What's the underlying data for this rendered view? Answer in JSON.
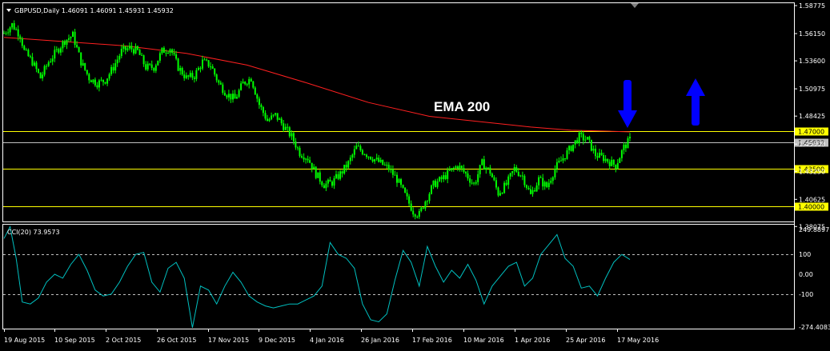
{
  "chart_data": [
    {
      "type": "candlestick",
      "title": "GBPUSD,Daily  1.46091 1.46091 1.45931 1.45932",
      "symbol": "GBPUSD",
      "timeframe": "Daily",
      "ohlc": {
        "open": 1.46091,
        "high": 1.46091,
        "low": 1.45931,
        "close": 1.45932
      },
      "ylim": [
        1.3855,
        1.59
      ],
      "y_ticks": [
        1.58775,
        1.5615,
        1.536,
        1.50975,
        1.48425,
        1.458,
        1.4325,
        1.40625,
        1.38075
      ],
      "y_tick_labels": [
        "1.58775",
        "1.56150",
        "1.53600",
        "1.50975",
        "1.48425",
        "1.45800",
        "1.43250",
        "1.40625",
        "1.38075"
      ],
      "x_tick_labels": [
        "19 Aug 2015",
        "10 Sep 2015",
        "2 Oct 2015",
        "26 Oct 2015",
        "17 Nov 2015",
        "9 Dec 2015",
        "4 Jan 2016",
        "26 Jan 2016",
        "17 Feb 2016",
        "10 Mar 2016",
        "1 Apr 2016",
        "25 Apr 2016",
        "17 May 2016"
      ],
      "horizontal_levels": [
        {
          "value": 1.47,
          "label": "1.47000",
          "color": "#ffff00"
        },
        {
          "value": 1.435,
          "label": "1.43500",
          "color": "#ffff00"
        },
        {
          "value": 1.4,
          "label": "1.40000",
          "color": "#ffff00"
        },
        {
          "value": 1.45932,
          "label": "1.45932",
          "color": "#c0c0c0"
        }
      ],
      "close_path": [
        [
          0,
          1.562
        ],
        [
          4,
          1.57
        ],
        [
          8,
          1.56
        ],
        [
          10,
          1.545
        ],
        [
          14,
          1.535
        ],
        [
          18,
          1.52
        ],
        [
          22,
          1.535
        ],
        [
          26,
          1.545
        ],
        [
          30,
          1.555
        ],
        [
          34,
          1.56
        ],
        [
          38,
          1.535
        ],
        [
          42,
          1.52
        ],
        [
          46,
          1.515
        ],
        [
          50,
          1.518
        ],
        [
          54,
          1.53
        ],
        [
          58,
          1.545
        ],
        [
          62,
          1.548
        ],
        [
          66,
          1.545
        ],
        [
          70,
          1.53
        ],
        [
          74,
          1.53
        ],
        [
          78,
          1.545
        ],
        [
          82,
          1.548
        ],
        [
          86,
          1.53
        ],
        [
          90,
          1.52
        ],
        [
          94,
          1.522
        ],
        [
          98,
          1.535
        ],
        [
          102,
          1.532
        ],
        [
          106,
          1.515
        ],
        [
          110,
          1.505
        ],
        [
          114,
          1.5
        ],
        [
          118,
          1.515
        ],
        [
          122,
          1.52
        ],
        [
          126,
          1.495
        ],
        [
          130,
          1.48
        ],
        [
          134,
          1.485
        ],
        [
          138,
          1.475
        ],
        [
          142,
          1.465
        ],
        [
          146,
          1.45
        ],
        [
          150,
          1.445
        ],
        [
          154,
          1.43
        ],
        [
          158,
          1.42
        ],
        [
          162,
          1.422
        ],
        [
          166,
          1.43
        ],
        [
          170,
          1.44
        ],
        [
          174,
          1.455
        ],
        [
          178,
          1.45
        ],
        [
          182,
          1.445
        ],
        [
          186,
          1.44
        ],
        [
          190,
          1.435
        ],
        [
          194,
          1.425
        ],
        [
          198,
          1.41
        ],
        [
          202,
          1.395
        ],
        [
          205,
          1.392
        ],
        [
          208,
          1.405
        ],
        [
          212,
          1.42
        ],
        [
          216,
          1.425
        ],
        [
          220,
          1.432
        ],
        [
          224,
          1.438
        ],
        [
          228,
          1.43
        ],
        [
          232,
          1.42
        ],
        [
          236,
          1.44
        ],
        [
          240,
          1.432
        ],
        [
          244,
          1.412
        ],
        [
          248,
          1.42
        ],
        [
          252,
          1.435
        ],
        [
          256,
          1.428
        ],
        [
          260,
          1.41
        ],
        [
          264,
          1.425
        ],
        [
          268,
          1.418
        ],
        [
          272,
          1.435
        ],
        [
          276,
          1.445
        ],
        [
          280,
          1.455
        ],
        [
          284,
          1.465
        ],
        [
          288,
          1.462
        ],
        [
          292,
          1.448
        ],
        [
          296,
          1.445
        ],
        [
          300,
          1.44
        ],
        [
          302,
          1.438
        ],
        [
          306,
          1.455
        ],
        [
          309,
          1.462
        ]
      ],
      "ema_200": [
        [
          0,
          1.558
        ],
        [
          60,
          1.55
        ],
        [
          90,
          1.543
        ],
        [
          120,
          1.532
        ],
        [
          150,
          1.515
        ],
        [
          180,
          1.497
        ],
        [
          210,
          1.484
        ],
        [
          240,
          1.478
        ],
        [
          260,
          1.474
        ],
        [
          280,
          1.471
        ],
        [
          300,
          1.47
        ],
        [
          309,
          1.4695
        ]
      ],
      "ema_color": "#ff2020",
      "candle_color": "#00ff00",
      "annotations": [
        {
          "text": "EMA 200"
        },
        {
          "kind": "arrow",
          "direction": "down",
          "color": "#0000ff",
          "at": 1.47
        },
        {
          "kind": "arrow",
          "direction": "up",
          "color": "#0000ff"
        }
      ],
      "grid": false
    },
    {
      "type": "line",
      "title": "CCI(20) 73.9573",
      "indicator": "CCI(20)",
      "current_value": 73.9573,
      "ylim": [
        -274.4083,
        249.8897
      ],
      "y_ticks": [
        249.8897,
        100,
        0.0,
        -100,
        -274.4083
      ],
      "y_tick_labels": [
        "249.8897",
        "100",
        "0.00",
        "-100",
        "-274.4083"
      ],
      "dashed_levels": [
        100,
        -100
      ],
      "line_color": "#00c0c0",
      "values": [
        [
          0,
          180
        ],
        [
          3,
          240
        ],
        [
          6,
          80
        ],
        [
          9,
          -140
        ],
        [
          13,
          -150
        ],
        [
          17,
          -120
        ],
        [
          21,
          -40
        ],
        [
          25,
          0
        ],
        [
          29,
          -20
        ],
        [
          33,
          50
        ],
        [
          37,
          100
        ],
        [
          41,
          20
        ],
        [
          45,
          -80
        ],
        [
          49,
          -110
        ],
        [
          53,
          -100
        ],
        [
          57,
          -40
        ],
        [
          61,
          40
        ],
        [
          65,
          100
        ],
        [
          69,
          110
        ],
        [
          73,
          -40
        ],
        [
          77,
          -90
        ],
        [
          81,
          30
        ],
        [
          85,
          60
        ],
        [
          89,
          -20
        ],
        [
          93,
          -270
        ],
        [
          97,
          -60
        ],
        [
          101,
          -80
        ],
        [
          105,
          -150
        ],
        [
          109,
          -60
        ],
        [
          113,
          10
        ],
        [
          117,
          -40
        ],
        [
          121,
          -110
        ],
        [
          125,
          -140
        ],
        [
          129,
          -160
        ],
        [
          133,
          -170
        ],
        [
          137,
          -160
        ],
        [
          141,
          -150
        ],
        [
          145,
          -150
        ],
        [
          149,
          -130
        ],
        [
          153,
          -110
        ],
        [
          157,
          -60
        ],
        [
          161,
          160
        ],
        [
          165,
          100
        ],
        [
          169,
          80
        ],
        [
          173,
          30
        ],
        [
          177,
          -150
        ],
        [
          181,
          -230
        ],
        [
          185,
          -240
        ],
        [
          189,
          -200
        ],
        [
          193,
          -30
        ],
        [
          197,
          120
        ],
        [
          201,
          60
        ],
        [
          205,
          -60
        ],
        [
          209,
          140
        ],
        [
          213,
          40
        ],
        [
          217,
          -40
        ],
        [
          221,
          20
        ],
        [
          225,
          -20
        ],
        [
          229,
          50
        ],
        [
          233,
          -30
        ],
        [
          237,
          -150
        ],
        [
          241,
          -60
        ],
        [
          245,
          -10
        ],
        [
          249,
          40
        ],
        [
          253,
          60
        ],
        [
          257,
          -60
        ],
        [
          261,
          -20
        ],
        [
          265,
          100
        ],
        [
          269,
          150
        ],
        [
          273,
          200
        ],
        [
          277,
          80
        ],
        [
          281,
          40
        ],
        [
          285,
          -70
        ],
        [
          289,
          -60
        ],
        [
          293,
          -110
        ],
        [
          297,
          -20
        ],
        [
          301,
          60
        ],
        [
          305,
          100
        ],
        [
          309,
          74
        ]
      ]
    }
  ]
}
